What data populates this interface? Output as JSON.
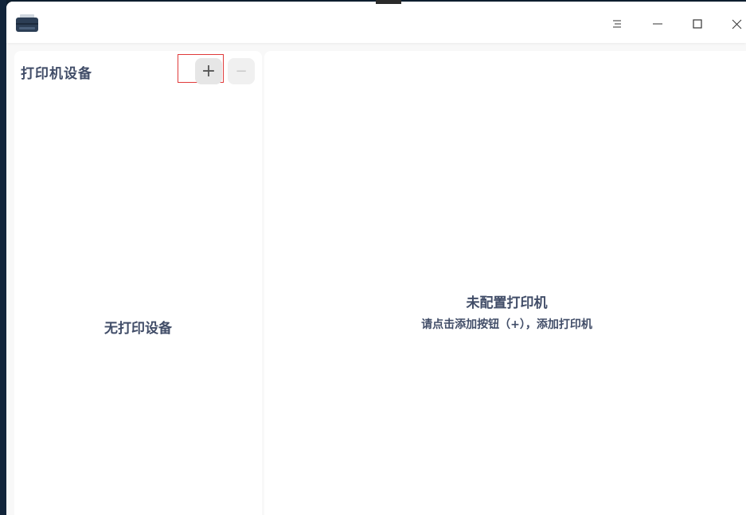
{
  "titlebar": {
    "app_icon": "printer-icon",
    "menu_icon": "menu-icon",
    "minimize_icon": "minimize-icon",
    "maximize_icon": "maximize-icon",
    "close_icon": "close-icon"
  },
  "sidebar": {
    "title": "打印机设备",
    "add_label": "+",
    "remove_label": "−",
    "empty_text": "无打印设备"
  },
  "main": {
    "title": "未配置打印机",
    "hint": "请点击添加按钮（+），添加打印机"
  },
  "colors": {
    "text": "#414d68",
    "highlight": "#e03a3a",
    "desktop": "#0e1e2e"
  }
}
